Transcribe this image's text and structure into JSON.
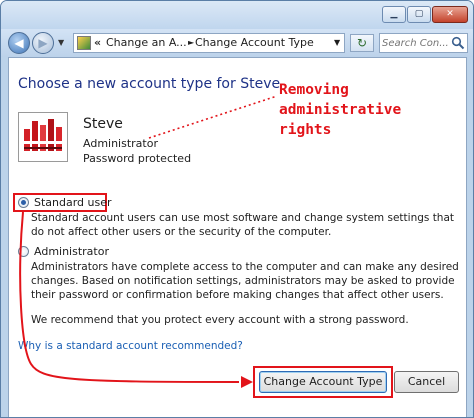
{
  "window": {
    "minimize_icon": "minimize-icon",
    "maximize_icon": "maximize-icon",
    "close_icon": "close-icon",
    "close_glyph": "✕",
    "minimize_glyph": "▁",
    "maximize_glyph": "▢"
  },
  "navbar": {
    "back_glyph": "◀",
    "forward_glyph": "▶",
    "dropdown_glyph": "▼",
    "address": {
      "chevron": "«",
      "crumbs": [
        "Change an A...",
        "Change Account Type"
      ],
      "separator": "►",
      "dropdown": "▼"
    },
    "refresh_glyph": "↻",
    "search_placeholder": "Search Con..."
  },
  "main": {
    "heading": "Choose a new account type for Steve",
    "user": {
      "name": "Steve",
      "role": "Administrator",
      "password_status": "Password protected"
    },
    "annotation": "Removing administrative rights",
    "options": [
      {
        "label": "Standard user",
        "checked": true,
        "description": "Standard account users can use most software and change system settings that do not affect other users or the security of the computer."
      },
      {
        "label": "Administrator",
        "checked": false,
        "description": "Administrators have complete access to the computer and can make any desired changes. Based on notification settings, administrators may be asked to provide their password or confirmation before making changes that affect other users."
      }
    ],
    "recommendation": "We recommend that you protect every account with a strong password.",
    "help_link": "Why is a standard account recommended?",
    "buttons": {
      "change": "Change Account Type",
      "cancel": "Cancel"
    }
  },
  "colors": {
    "annotation_red": "#e2141a",
    "heading_blue": "#1e3287",
    "link_blue": "#1a5fb4",
    "chrome_blue": "#bcd3ea"
  }
}
